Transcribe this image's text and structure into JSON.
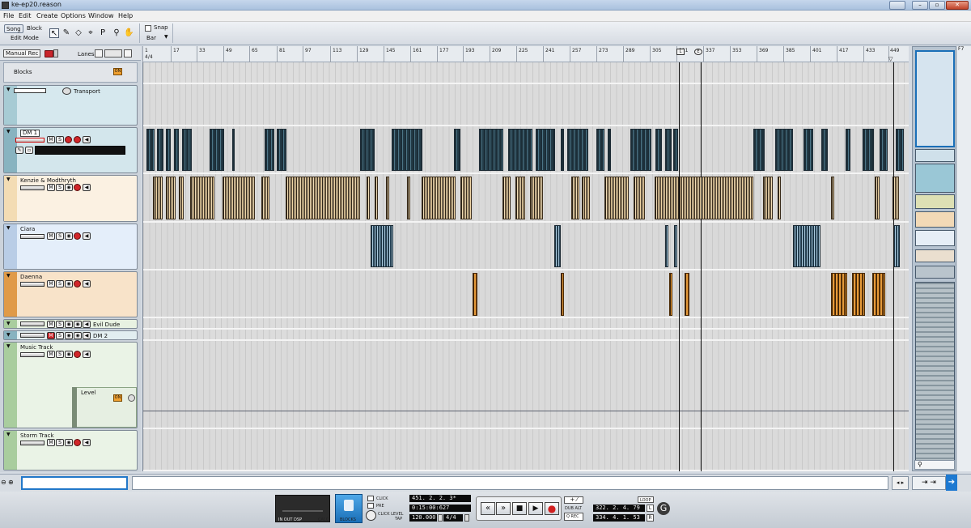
{
  "window": {
    "title": "ke-ep20.reason",
    "buttons": [
      "",
      "–",
      "▫",
      "✕"
    ]
  },
  "menu": [
    "File",
    "Edit",
    "Create",
    "Options",
    "Window",
    "Help"
  ],
  "toolbar": {
    "song_label": "Song",
    "block_label": "Block",
    "edit_mode_label": "Edit Mode",
    "snap_label": "Snap",
    "snap_value": "Bar",
    "tools": [
      "arrow-tool-icon",
      "pencil-tool-icon",
      "eraser-tool-icon",
      "razor-tool-icon",
      "mute-tool-icon",
      "magnify-tool-icon",
      "hand-tool-icon"
    ]
  },
  "header": {
    "manual_rec": "Manual Rec",
    "lanes": "Lanes",
    "blocks": "Blocks",
    "on": "ON"
  },
  "tracks": {
    "transport": "Transport",
    "dm1": "DM 1",
    "kenzie": "Kenzie & Modthryth",
    "ciara": "Ciara",
    "daenna": "Daenna",
    "evil": "Evil Dude",
    "dm2": "DM 2",
    "music": "Music Track",
    "level": "Level",
    "storm": "Storm Track"
  },
  "ruler": {
    "bars": [
      "1",
      "17",
      "33",
      "49",
      "65",
      "81",
      "97",
      "113",
      "129",
      "145",
      "161",
      "177",
      "193",
      "209",
      "225",
      "241",
      "257",
      "273",
      "289",
      "305",
      "321",
      "337",
      "353",
      "369",
      "385",
      "401",
      "417",
      "433",
      "449"
    ],
    "first_sig": "4/4"
  },
  "transport": {
    "position_bars": "451. 2. 2. 3*",
    "position_time": "0:15:00:627",
    "tempo": "120.000",
    "signature": "4/4",
    "click": "CLICK",
    "pre": "PRE",
    "click_level": "CLICK LEVEL",
    "tap": "TAP",
    "blocks": "BLOCKS",
    "in_out": "IN  OUT  DSP",
    "calc": "CALC",
    "loop": "LOOP",
    "loop_left": "322. 2. 4. 79",
    "loop_right": "334. 4. 1. 53",
    "dub_alt": "DUB  ALT",
    "q_rec": "Q REC",
    "lr_left": "L",
    "lr_right": "R"
  },
  "right_label": "F7"
}
